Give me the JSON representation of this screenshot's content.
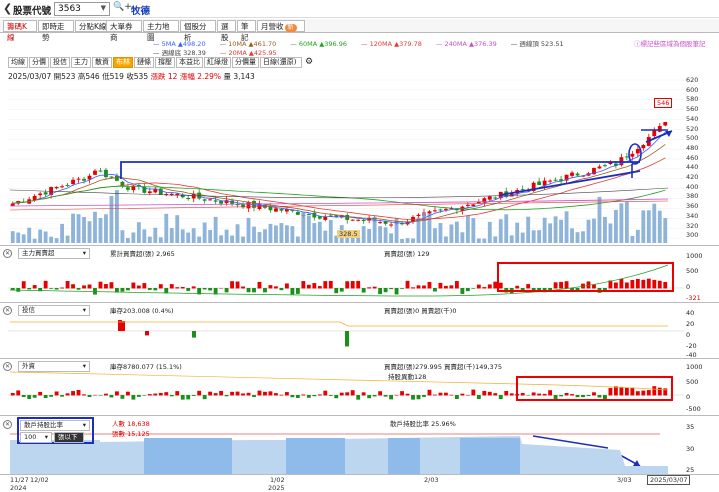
{
  "header": {
    "back_glyph": "❮",
    "title": "股票代號",
    "code": "3563",
    "search_glyph": "🔍+",
    "stock_name": "牧德"
  },
  "tabs": [
    {
      "label": "籌碼K線",
      "active": true
    },
    {
      "label": "即時走勢",
      "active": false
    },
    {
      "label": "分點K線",
      "active": false
    },
    {
      "label": "大單券商",
      "active": false
    },
    {
      "label": "主力地圖",
      "active": false
    },
    {
      "label": "個股分析",
      "active": false
    },
    {
      "label": "選股",
      "active": false
    },
    {
      "label": "筆記",
      "active": false
    },
    {
      "label": "月營收",
      "active": false,
      "badge": "新"
    }
  ],
  "ma_legend": {
    "row1": [
      {
        "label": "5MA ▲498.20",
        "color": "#3b5fff"
      },
      {
        "label": "10MA ▲461.70",
        "color": "#9c5d19"
      },
      {
        "label": "60MA ▲396.96",
        "color": "#22a322"
      },
      {
        "label": "120MA ▲379.78",
        "color": "#e53935"
      },
      {
        "label": "240MA ▲376.39",
        "color": "#c94fc9"
      },
      {
        "label": "週線頂 523.51",
        "color": "#444444"
      }
    ],
    "row2": [
      {
        "label": "週線底 328.39",
        "color": "#444444"
      },
      {
        "label": "20MA ▲425.95",
        "color": "#e53935"
      }
    ],
    "hint": "標記些區域為個股筆記"
  },
  "toolbar": {
    "buttons": [
      "均線",
      "分價",
      "投信",
      "主力",
      "散資",
      "布林",
      "鏈條",
      "撐壓",
      "本益比",
      "紅綠燈",
      "分價量"
    ],
    "active_index": 5,
    "period": "日線(還原)",
    "settings_glyph": "⚙"
  },
  "quote": {
    "date": "2025/03/07",
    "open_label": "開",
    "open": "523",
    "high_label": "高",
    "high": "546",
    "low_label": "低",
    "low": "519",
    "close_label": "收",
    "close": "535",
    "change_label": "漲跌",
    "change": "12",
    "pct_label": "漲幅",
    "pct": "2.29%",
    "vol_label": "量",
    "vol": "3,143"
  },
  "price_axis": [
    "620",
    "600",
    "580",
    "560",
    "540",
    "520",
    "500",
    "480",
    "460",
    "440",
    "420",
    "400",
    "380",
    "360",
    "340",
    "320",
    "300"
  ],
  "high_marker": "546",
  "low_marker": "328.5",
  "panels": {
    "main_force": {
      "selector": "主力買賣超",
      "left_text": "累計買賣超(張) 2,965",
      "right_text": "買賣超(張) 129",
      "axis": [
        "1000",
        "500",
        "0",
        "-321"
      ]
    },
    "investment_trust": {
      "selector": "投信",
      "left_text": "庫存203.008 (0.4%)",
      "right_text": "買賣超(張)0 買賣超(千)0",
      "axis": [
        "40",
        "20",
        "0",
        "-20",
        "-40"
      ]
    },
    "foreign": {
      "selector": "外資",
      "left_text": "庫存8780.077 (15.1%)",
      "right_text": "買賣超(張)279.995 買賣超(千)149,375",
      "right_text2": "持股異動128",
      "axis": [
        "1000",
        "500",
        "0",
        "-500"
      ]
    },
    "retail": {
      "selector": "散戶持股比率",
      "threshold": "100",
      "threshold_mode": "張以下",
      "left_text1": "人數 18,638",
      "left_text2": "張數 15,125",
      "right_text": "散戶持股比率 25.96%",
      "axis": [
        "35",
        "30",
        "25"
      ]
    }
  },
  "dates": [
    {
      "label": "11/27",
      "sub": "2024"
    },
    {
      "label": "12/02",
      "sub": ""
    },
    {
      "label": "1/02",
      "sub": "2025"
    },
    {
      "label": "2/03",
      "sub": ""
    },
    {
      "label": "3/03",
      "sub": ""
    },
    {
      "label": "2025/03/07",
      "sub": ""
    }
  ],
  "colors": {
    "up": "#e60000",
    "down": "#1a8f1a",
    "volume": "#7ba7d4",
    "annotation_blue": "#1a2fbf",
    "annotation_red": "#e60000"
  }
}
